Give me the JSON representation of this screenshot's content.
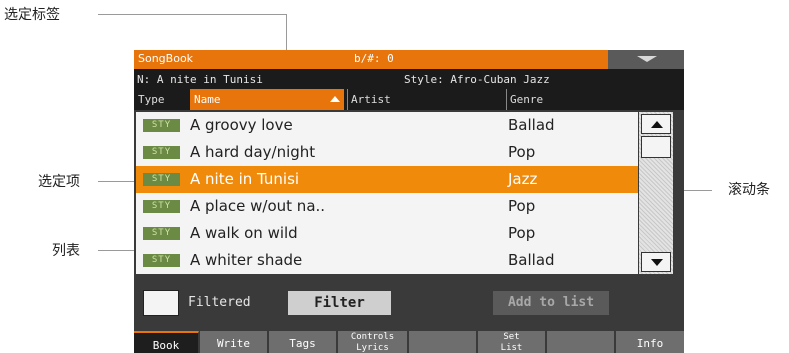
{
  "callouts": {
    "selected_tab": "选定标签",
    "selected_item": "选定项",
    "list": "列表",
    "scrollbar": "滚动条"
  },
  "topbar": {
    "app_title": "SongBook",
    "transpose": "b/#: 0"
  },
  "info": {
    "song": "N: A nite in Tunisi",
    "style": "Style: Afro-Cuban Jazz"
  },
  "columns": {
    "type": "Type",
    "name": "Name",
    "artist": "Artist",
    "genre": "Genre"
  },
  "rows": [
    {
      "badge": "STY",
      "title": "A groovy love",
      "genre": "Ballad",
      "selected": false
    },
    {
      "badge": "STY",
      "title": "A hard day/night",
      "genre": "Pop",
      "selected": false
    },
    {
      "badge": "STY",
      "title": "A nite in Tunisi",
      "genre": "Jazz",
      "selected": true
    },
    {
      "badge": "STY",
      "title": "A place w/out na..",
      "genre": "Pop",
      "selected": false
    },
    {
      "badge": "STY",
      "title": "A walk on wild",
      "genre": "Pop",
      "selected": false
    },
    {
      "badge": "STY",
      "title": "A whiter shade",
      "genre": "Ballad",
      "selected": false
    }
  ],
  "controls": {
    "filtered_label": "Filtered",
    "filter_button": "Filter",
    "add_button": "Add to list"
  },
  "tabs": [
    {
      "line1": "Book",
      "line2": "",
      "active": true
    },
    {
      "line1": "Write",
      "line2": "",
      "active": false
    },
    {
      "line1": "Tags",
      "line2": "",
      "active": false
    },
    {
      "line1": "Controls",
      "line2": "Lyrics",
      "active": false
    },
    {
      "line1": "",
      "line2": "",
      "active": false
    },
    {
      "line1": "Set",
      "line2": "List",
      "active": false
    },
    {
      "line1": "",
      "line2": "",
      "active": false
    },
    {
      "line1": "Info",
      "line2": "",
      "active": false
    }
  ],
  "colors": {
    "accent": "#e8740c",
    "selected_row": "#f08a0a",
    "badge": "#6b8a43"
  },
  "icons": {
    "menu": "chevron-down-icon",
    "sort": "sort-ascending-icon",
    "scroll_up": "arrow-up-icon",
    "scroll_down": "arrow-down-icon"
  }
}
